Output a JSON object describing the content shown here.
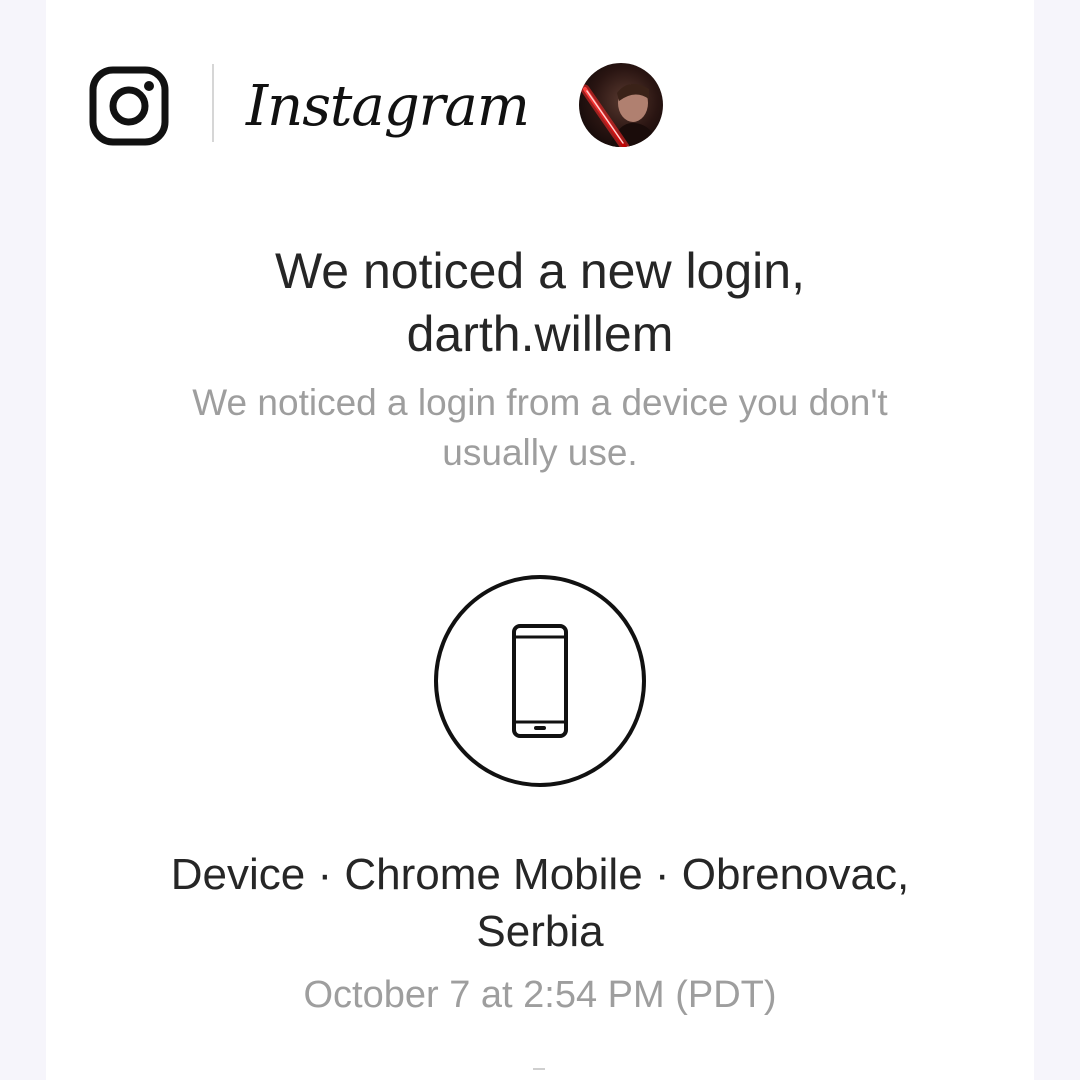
{
  "header": {
    "logo_icon": "instagram-camera-icon",
    "wordmark": "Instagram",
    "avatar_description": "profile-avatar"
  },
  "message": {
    "headline_line1": "We noticed a new login,",
    "headline_line2": "darth.willem",
    "subtext_line1": "We noticed a login from a device you don't",
    "subtext_line2": "usually use."
  },
  "device": {
    "icon": "smartphone-icon",
    "details_line1": "Device · Chrome Mobile · Obrenovac,",
    "details_line2": "Serbia",
    "timestamp": "October 7 at 2:54 PM (PDT)"
  },
  "colors": {
    "page_bg": "#f6f5fb",
    "card_bg": "#ffffff",
    "primary_text": "#262626",
    "secondary_text": "#9e9e9e"
  }
}
